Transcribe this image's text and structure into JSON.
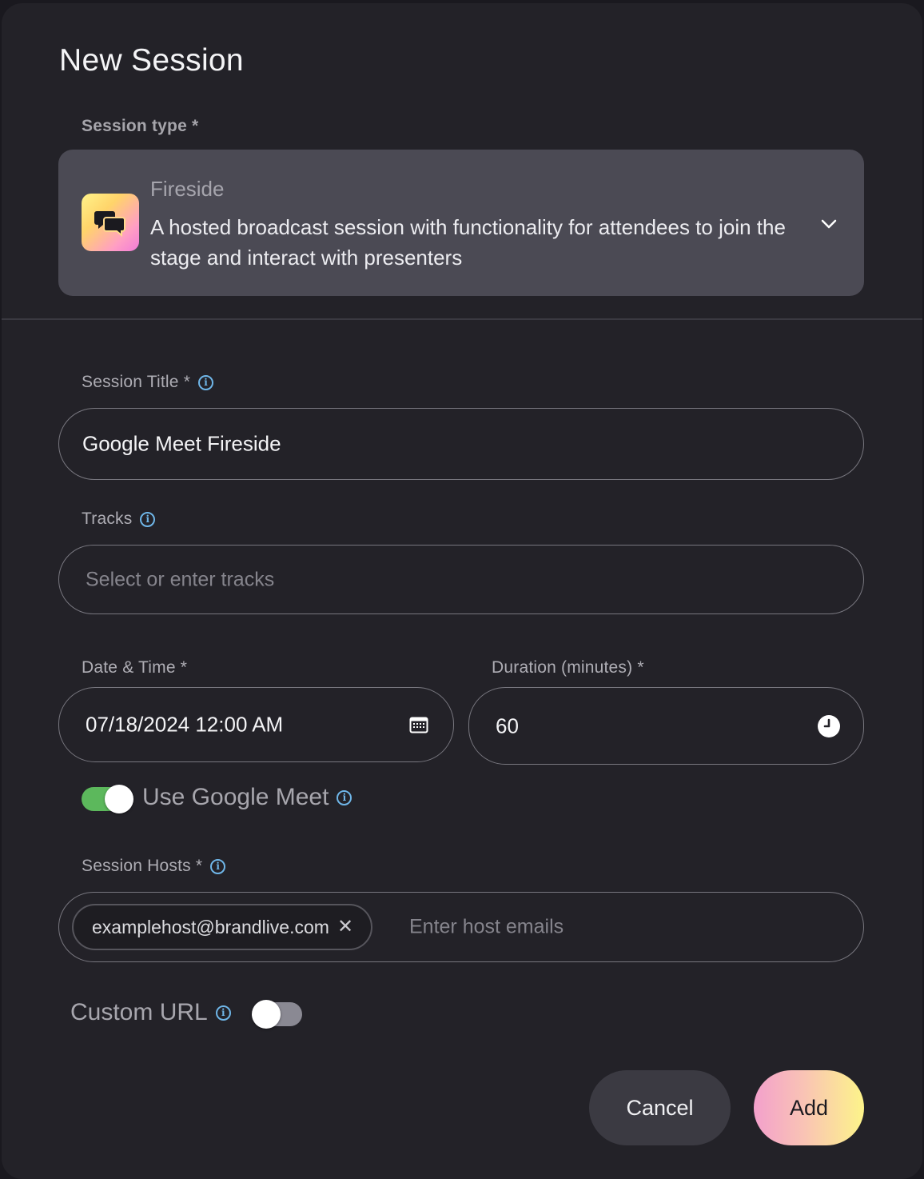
{
  "modal": {
    "title": "New Session"
  },
  "session_type": {
    "label": "Session type *",
    "selected_name": "Fireside",
    "selected_description": "A hosted broadcast session with functionality for attendees to join the stage and interact with presenters",
    "icon": "chat-bubbles-icon"
  },
  "session_title": {
    "label": "Session Title *",
    "value": "Google Meet Fireside"
  },
  "tracks": {
    "label": "Tracks",
    "placeholder": "Select or enter tracks"
  },
  "date_time": {
    "label": "Date & Time *",
    "value": "07/18/2024 12:00 AM",
    "icon": "calendar-icon"
  },
  "duration": {
    "label": "Duration (minutes) *",
    "value": "60",
    "icon": "clock-icon"
  },
  "google_meet": {
    "label": "Use Google Meet",
    "enabled": true
  },
  "session_hosts": {
    "label": "Session Hosts *",
    "chips": [
      "examplehost@brandlive.com"
    ],
    "placeholder": "Enter host emails"
  },
  "custom_url": {
    "label": "Custom URL",
    "enabled": false
  },
  "actions": {
    "cancel_label": "Cancel",
    "add_label": "Add"
  },
  "colors": {
    "toggle_on": "#5cb85c",
    "toggle_off": "#8a8993",
    "info_icon": "#6fb6e8"
  }
}
